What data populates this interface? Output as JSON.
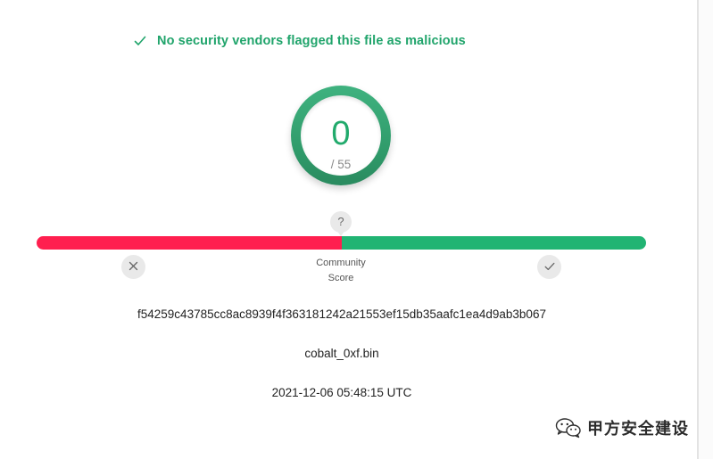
{
  "status": {
    "icon": "check-icon",
    "text": "No security vendors flagged this file as malicious",
    "color": "#20a46b"
  },
  "detection": {
    "positives": "0",
    "total": "/ 55",
    "ring_color": "#3aa874"
  },
  "community_score": {
    "badge": "?",
    "label_line1": "Community",
    "label_line2": "Score",
    "bar_negative_color": "#ff1f4f",
    "bar_positive_color": "#21b473",
    "bar_negative_fraction": 0.5,
    "harmful_icon": "close-icon",
    "harmless_icon": "check-icon"
  },
  "file": {
    "sha256": "f54259c43785cc8ac8939f4f363181242a21553ef15db35aafc1ea4d9ab3b067",
    "name": "cobalt_0xf.bin",
    "analysis_date": "2021-12-06 05:48:15 UTC"
  },
  "watermark": {
    "icon": "wechat-icon",
    "text": "甲方安全建设"
  }
}
